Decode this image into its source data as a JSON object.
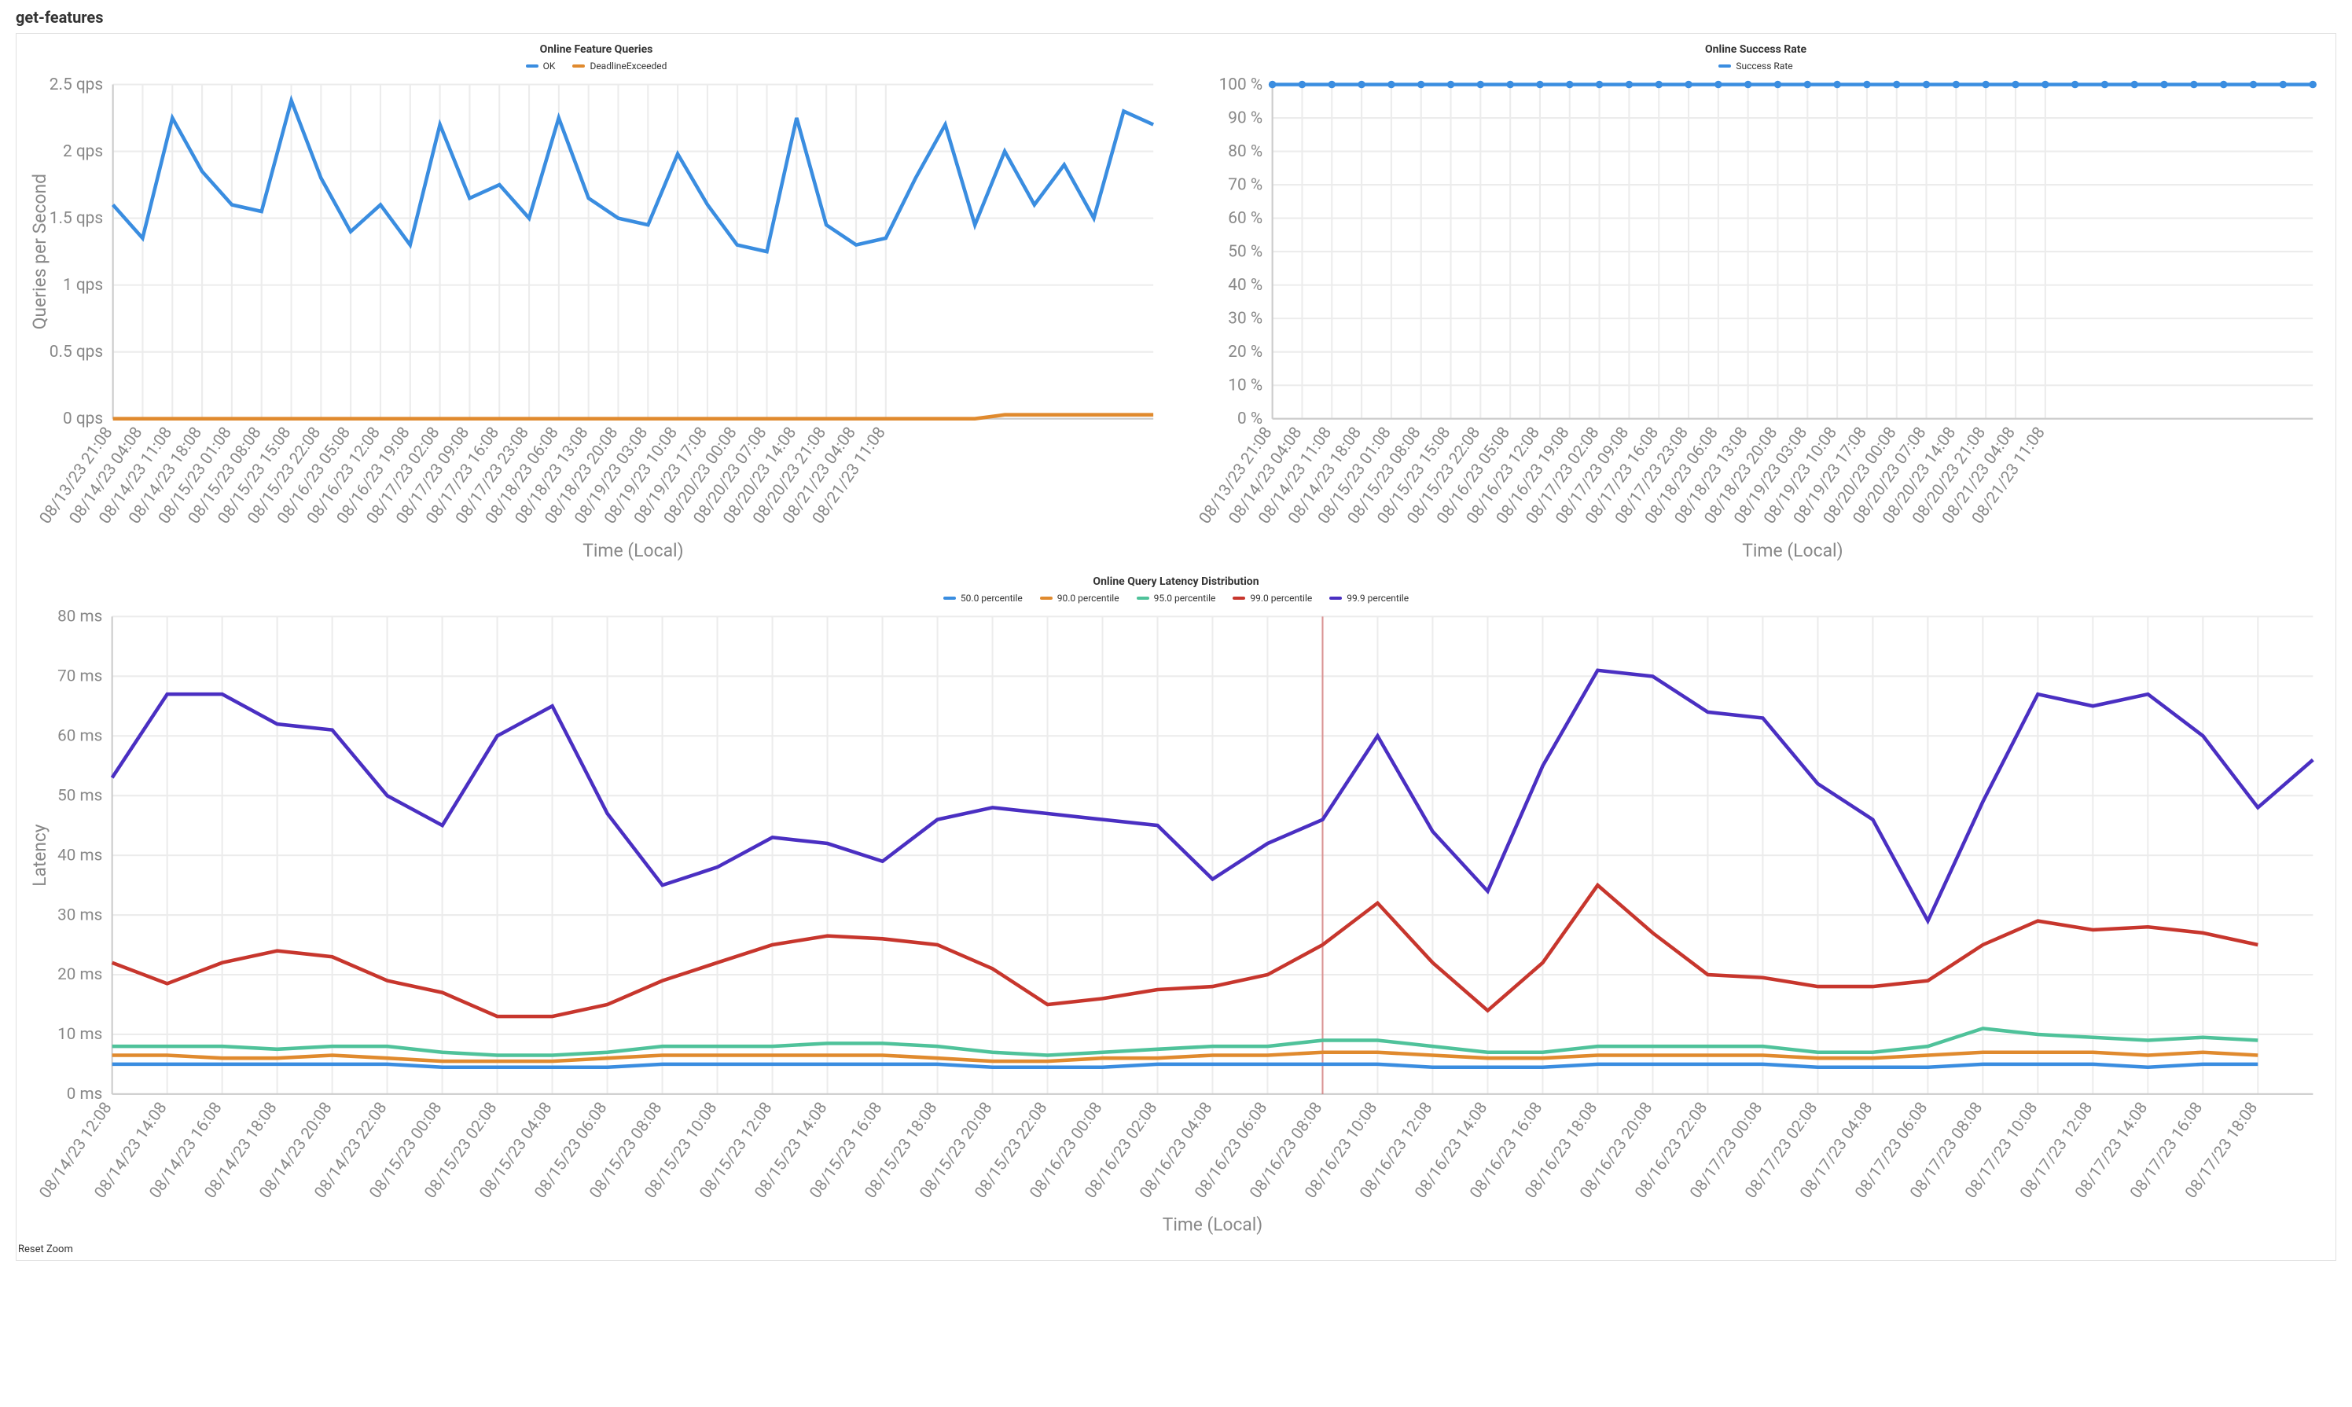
{
  "page_title": "get-features",
  "reset_zoom_label": "Reset Zoom",
  "colors": {
    "ok": "#3a8de0",
    "deadline": "#e08a2e",
    "success_rate": "#3a8de0",
    "p50": "#3a8de0",
    "p90": "#e08a2e",
    "p95": "#4fc29a",
    "p99": "#c7362d",
    "p999": "#4a2fc2"
  },
  "chart_data": [
    {
      "id": "queries",
      "type": "line",
      "title": "Online Feature Queries",
      "xlabel": "Time (Local)",
      "ylabel": "Queries per Second",
      "ylim": [
        0,
        2.5
      ],
      "ytick": 0.5,
      "y_unit": " qps",
      "legend": [
        {
          "name": "OK",
          "color_key": "ok"
        },
        {
          "name": "DeadlineExceeded",
          "color_key": "deadline"
        }
      ],
      "categories": [
        "08/13/23 21:08",
        "08/14/23 04:08",
        "08/14/23 11:08",
        "08/14/23 18:08",
        "08/15/23 01:08",
        "08/15/23 08:08",
        "08/15/23 15:08",
        "08/15/23 22:08",
        "08/16/23 05:08",
        "08/16/23 12:08",
        "08/16/23 19:08",
        "08/17/23 02:08",
        "08/17/23 09:08",
        "08/17/23 16:08",
        "08/17/23 23:08",
        "08/18/23 06:08",
        "08/18/23 13:08",
        "08/18/23 20:08",
        "08/19/23 03:08",
        "08/19/23 10:08",
        "08/19/23 17:08",
        "08/20/23 00:08",
        "08/20/23 07:08",
        "08/20/23 14:08",
        "08/20/23 21:08",
        "08/21/23 04:08",
        "08/21/23 11:08"
      ],
      "series": [
        {
          "name": "OK",
          "color_key": "ok",
          "values": [
            1.6,
            1.35,
            2.25,
            1.85,
            1.6,
            1.55,
            2.38,
            1.8,
            1.4,
            1.6,
            1.3,
            2.2,
            1.65,
            1.75,
            1.5,
            2.25,
            1.65,
            1.5,
            1.45,
            1.98,
            1.6,
            1.3,
            1.25,
            2.25,
            1.45,
            1.3,
            1.35
          ],
          "values_extra": [
            1.8,
            2.2,
            1.45,
            2.0,
            1.6,
            1.9,
            1.5,
            2.3,
            2.2
          ]
        },
        {
          "name": "DeadlineExceeded",
          "color_key": "deadline",
          "values": [
            0,
            0,
            0,
            0,
            0,
            0,
            0,
            0,
            0,
            0,
            0,
            0,
            0,
            0,
            0,
            0,
            0,
            0,
            0,
            0,
            0,
            0,
            0,
            0,
            0,
            0,
            0
          ],
          "values_extra": [
            0,
            0,
            0,
            0.03,
            0.03,
            0.03,
            0.03,
            0.03,
            0.03
          ]
        }
      ]
    },
    {
      "id": "success",
      "type": "line",
      "title": "Online Success Rate",
      "xlabel": "Time (Local)",
      "ylabel": "",
      "ylim": [
        0,
        100
      ],
      "ytick": 10,
      "y_unit": " %",
      "legend": [
        {
          "name": "Success Rate",
          "color_key": "success_rate"
        }
      ],
      "categories": [
        "08/13/23 21:08",
        "08/14/23 04:08",
        "08/14/23 11:08",
        "08/14/23 18:08",
        "08/15/23 01:08",
        "08/15/23 08:08",
        "08/15/23 15:08",
        "08/15/23 22:08",
        "08/16/23 05:08",
        "08/16/23 12:08",
        "08/16/23 19:08",
        "08/17/23 02:08",
        "08/17/23 09:08",
        "08/17/23 16:08",
        "08/17/23 23:08",
        "08/18/23 06:08",
        "08/18/23 13:08",
        "08/18/23 20:08",
        "08/19/23 03:08",
        "08/19/23 10:08",
        "08/19/23 17:08",
        "08/20/23 00:08",
        "08/20/23 07:08",
        "08/20/23 14:08",
        "08/20/23 21:08",
        "08/21/23 04:08",
        "08/21/23 11:08"
      ],
      "series": [
        {
          "name": "Success Rate",
          "color_key": "success_rate",
          "markers": true,
          "values": [
            100,
            100,
            100,
            100,
            100,
            100,
            100,
            100,
            100,
            100,
            100,
            100,
            100,
            100,
            100,
            100,
            100,
            100,
            100,
            100,
            100,
            100,
            100,
            100,
            100,
            100,
            100
          ],
          "values_extra": [
            100,
            100,
            100,
            100,
            100,
            100,
            100,
            100,
            100
          ]
        }
      ]
    },
    {
      "id": "latency",
      "type": "line",
      "title": "Online Query Latency Distribution",
      "xlabel": "Time (Local)",
      "ylabel": "Latency",
      "ylim": [
        0,
        80
      ],
      "ytick": 10,
      "y_unit": " ms",
      "marker_x_index": 22,
      "legend": [
        {
          "name": "50.0 percentile",
          "color_key": "p50"
        },
        {
          "name": "90.0 percentile",
          "color_key": "p90"
        },
        {
          "name": "95.0 percentile",
          "color_key": "p95"
        },
        {
          "name": "99.0 percentile",
          "color_key": "p99"
        },
        {
          "name": "99.9 percentile",
          "color_key": "p999"
        }
      ],
      "categories": [
        "08/14/23 12:08",
        "08/14/23 14:08",
        "08/14/23 16:08",
        "08/14/23 18:08",
        "08/14/23 20:08",
        "08/14/23 22:08",
        "08/15/23 00:08",
        "08/15/23 02:08",
        "08/15/23 04:08",
        "08/15/23 06:08",
        "08/15/23 08:08",
        "08/15/23 10:08",
        "08/15/23 12:08",
        "08/15/23 14:08",
        "08/15/23 16:08",
        "08/15/23 18:08",
        "08/15/23 20:08",
        "08/15/23 22:08",
        "08/16/23 00:08",
        "08/16/23 02:08",
        "08/16/23 04:08",
        "08/16/23 06:08",
        "08/16/23 08:08",
        "08/16/23 10:08",
        "08/16/23 12:08",
        "08/16/23 14:08",
        "08/16/23 16:08",
        "08/16/23 18:08",
        "08/16/23 20:08",
        "08/16/23 22:08",
        "08/17/23 00:08",
        "08/17/23 02:08",
        "08/17/23 04:08",
        "08/17/23 06:08",
        "08/17/23 08:08",
        "08/17/23 10:08",
        "08/17/23 12:08",
        "08/17/23 14:08",
        "08/17/23 16:08",
        "08/17/23 18:08"
      ],
      "series": [
        {
          "name": "50.0 percentile",
          "color_key": "p50",
          "values": [
            5,
            5,
            5,
            5,
            5,
            5,
            4.5,
            4.5,
            4.5,
            4.5,
            5,
            5,
            5,
            5,
            5,
            5,
            4.5,
            4.5,
            4.5,
            5,
            5,
            5,
            5,
            5,
            4.5,
            4.5,
            4.5,
            5,
            5,
            5,
            5,
            4.5,
            4.5,
            4.5,
            5,
            5,
            5,
            4.5,
            5,
            5
          ]
        },
        {
          "name": "90.0 percentile",
          "color_key": "p90",
          "values": [
            6.5,
            6.5,
            6,
            6,
            6.5,
            6,
            5.5,
            5.5,
            5.5,
            6,
            6.5,
            6.5,
            6.5,
            6.5,
            6.5,
            6,
            5.5,
            5.5,
            6,
            6,
            6.5,
            6.5,
            7,
            7,
            6.5,
            6,
            6,
            6.5,
            6.5,
            6.5,
            6.5,
            6,
            6,
            6.5,
            7,
            7,
            7,
            6.5,
            7,
            6.5
          ]
        },
        {
          "name": "95.0 percentile",
          "color_key": "p95",
          "values": [
            8,
            8,
            8,
            7.5,
            8,
            8,
            7,
            6.5,
            6.5,
            7,
            8,
            8,
            8,
            8.5,
            8.5,
            8,
            7,
            6.5,
            7,
            7.5,
            8,
            8,
            9,
            9,
            8,
            7,
            7,
            8,
            8,
            8,
            8,
            7,
            7,
            8,
            11,
            10,
            9.5,
            9,
            9.5,
            9
          ]
        },
        {
          "name": "99.0 percentile",
          "color_key": "p99",
          "values": [
            22,
            18.5,
            22,
            24,
            23,
            19,
            17,
            13,
            13,
            15,
            19,
            22,
            25,
            26.5,
            26,
            25,
            21,
            15,
            16,
            17.5,
            18,
            20,
            25,
            32,
            22,
            14,
            22,
            35,
            27,
            20,
            19.5,
            18,
            18,
            19,
            25,
            29,
            27.5,
            28,
            27,
            25
          ]
        },
        {
          "name": "99.9 percentile",
          "color_key": "p999",
          "values": [
            53,
            67,
            67,
            62,
            61,
            50,
            45,
            60,
            65,
            47,
            35,
            38,
            43,
            42,
            39,
            46,
            48,
            47,
            46,
            45,
            36,
            42,
            46,
            60,
            44,
            34,
            55,
            71,
            70,
            64,
            63,
            52,
            46,
            29,
            49,
            67,
            65,
            67,
            60,
            48
          ],
          "values_extra": [
            56
          ]
        }
      ]
    }
  ]
}
